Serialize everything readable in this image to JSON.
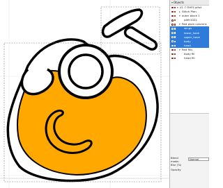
{
  "objects_panel": {
    "title": "Objects",
    "rows": [
      {
        "label": "V1 7 OHFS plfull",
        "depth": 0,
        "arrow": "▾",
        "selected": false
      },
      {
        "label": "Stitch Plan",
        "depth": 1,
        "arrow": "▸",
        "selected": false
      },
      {
        "label": "outer block 1",
        "depth": 1,
        "arrow": "▾",
        "selected": false
      },
      {
        "label": "path1021",
        "depth": 2,
        "arrow": "",
        "selected": false
      },
      {
        "label": "Red plain columns",
        "depth": 1,
        "arrow": "▾",
        "selected": false
      },
      {
        "label": "wings",
        "depth": 2,
        "arrow": "",
        "selected": true
      },
      {
        "label": "lower_hook",
        "depth": 2,
        "arrow": "",
        "selected": true
      },
      {
        "label": "upper_hook",
        "depth": 2,
        "arrow": "",
        "selected": true
      },
      {
        "label": "body",
        "depth": 2,
        "arrow": "",
        "selected": true
      },
      {
        "label": "head",
        "depth": 2,
        "arrow": "",
        "selected": true
      },
      {
        "label": "Red fills",
        "depth": 1,
        "arrow": "▾",
        "selected": false
      },
      {
        "label": "body fill",
        "depth": 2,
        "arrow": "",
        "selected": false
      },
      {
        "label": "head fill",
        "depth": 2,
        "arrow": "",
        "selected": false
      }
    ]
  },
  "blend": {
    "label": "Blend mode:",
    "value": "Normal"
  },
  "blur": {
    "label": "Blur (%)"
  },
  "opacity": {
    "label": "Opacity"
  },
  "colors": {
    "fill": "#ffa800",
    "stroke": "#000000",
    "selection": "#2f7bd9",
    "guide": "#7f7f7f"
  }
}
